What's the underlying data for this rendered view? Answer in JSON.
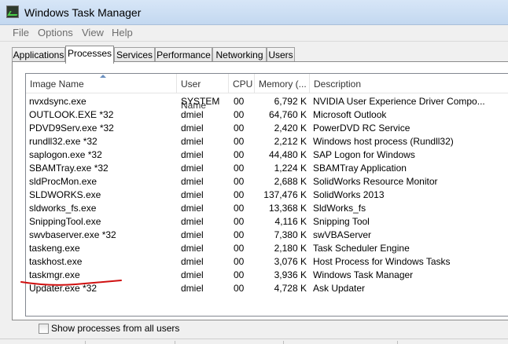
{
  "window": {
    "title": "Windows Task Manager"
  },
  "menu": [
    "File",
    "Options",
    "View",
    "Help"
  ],
  "tabs": [
    "Applications",
    "Processes",
    "Services",
    "Performance",
    "Networking",
    "Users"
  ],
  "active_tab": "Processes",
  "columns": [
    "Image Name",
    "User Name",
    "CPU",
    "Memory (...",
    "Description"
  ],
  "processes": [
    {
      "name": "nvxdsync.exe",
      "user": "SYSTEM",
      "cpu": "00",
      "memory": "6,792 K",
      "description": "NVIDIA User Experience Driver Compo..."
    },
    {
      "name": "OUTLOOK.EXE *32",
      "user": "dmiel",
      "cpu": "00",
      "memory": "64,760 K",
      "description": "Microsoft Outlook"
    },
    {
      "name": "PDVD9Serv.exe *32",
      "user": "dmiel",
      "cpu": "00",
      "memory": "2,420 K",
      "description": "PowerDVD RC Service"
    },
    {
      "name": "rundll32.exe *32",
      "user": "dmiel",
      "cpu": "00",
      "memory": "2,212 K",
      "description": "Windows host process (Rundll32)"
    },
    {
      "name": "saplogon.exe *32",
      "user": "dmiel",
      "cpu": "00",
      "memory": "44,480 K",
      "description": "SAP Logon for Windows"
    },
    {
      "name": "SBAMTray.exe *32",
      "user": "dmiel",
      "cpu": "00",
      "memory": "1,224 K",
      "description": "SBAMTray Application"
    },
    {
      "name": "sldProcMon.exe",
      "user": "dmiel",
      "cpu": "00",
      "memory": "2,688 K",
      "description": "SolidWorks Resource Monitor"
    },
    {
      "name": "SLDWORKS.exe",
      "user": "dmiel",
      "cpu": "00",
      "memory": "137,476 K",
      "description": "SolidWorks 2013"
    },
    {
      "name": "sldworks_fs.exe",
      "user": "dmiel",
      "cpu": "00",
      "memory": "13,368 K",
      "description": "SldWorks_fs"
    },
    {
      "name": "SnippingTool.exe",
      "user": "dmiel",
      "cpu": "00",
      "memory": "4,116 K",
      "description": "Snipping Tool"
    },
    {
      "name": "swvbaserver.exe *32",
      "user": "dmiel",
      "cpu": "00",
      "memory": "7,380 K",
      "description": "swVBAServer"
    },
    {
      "name": "taskeng.exe",
      "user": "dmiel",
      "cpu": "00",
      "memory": "2,180 K",
      "description": "Task Scheduler Engine"
    },
    {
      "name": "taskhost.exe",
      "user": "dmiel",
      "cpu": "00",
      "memory": "3,076 K",
      "description": "Host Process for Windows Tasks"
    },
    {
      "name": "taskmgr.exe",
      "user": "dmiel",
      "cpu": "00",
      "memory": "3,936 K",
      "description": "Windows Task Manager"
    },
    {
      "name": "Updater.exe *32",
      "user": "dmiel",
      "cpu": "00",
      "memory": "4,728 K",
      "description": "Ask Updater"
    }
  ],
  "show_all_label": "Show processes from all users",
  "show_all_checked": false,
  "annotation": {
    "color": "#d01010",
    "target": "swvbaserver.exe *32"
  },
  "icons": {
    "app": "task-manager-icon",
    "sort": "sort-ascending-icon"
  }
}
